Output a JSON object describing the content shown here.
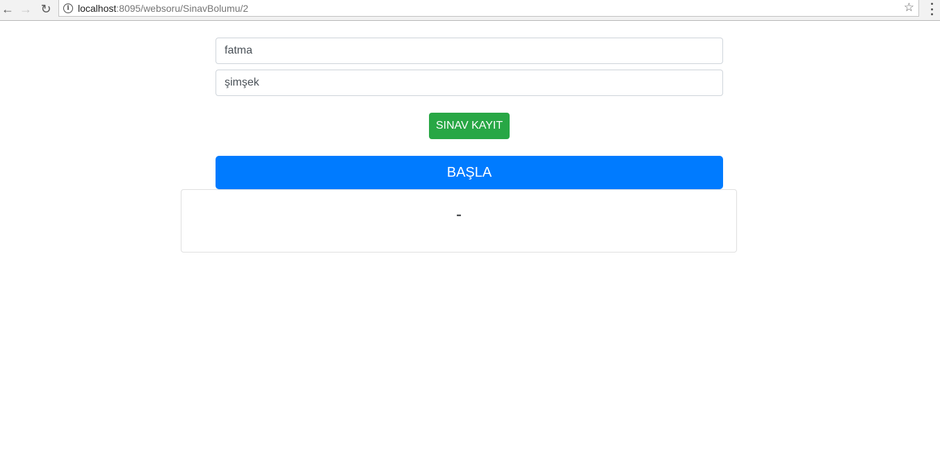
{
  "browser": {
    "url_host": "localhost",
    "url_rest": ":8095/websoru/SinavBolumu/2",
    "icons": {
      "back": "arrow-left",
      "forward": "arrow-right",
      "reload": "reload",
      "info": "info-circle",
      "bookmark": "star",
      "menu": "vertical-dots"
    }
  },
  "form": {
    "name_value": "fatma",
    "surname_value": "şimşek",
    "register_button_label": "SINAV KAYIT",
    "start_button_label": "BAŞLA"
  },
  "result": {
    "text": "-"
  },
  "colors": {
    "register_button": "#28a745",
    "start_button": "#007bff"
  }
}
